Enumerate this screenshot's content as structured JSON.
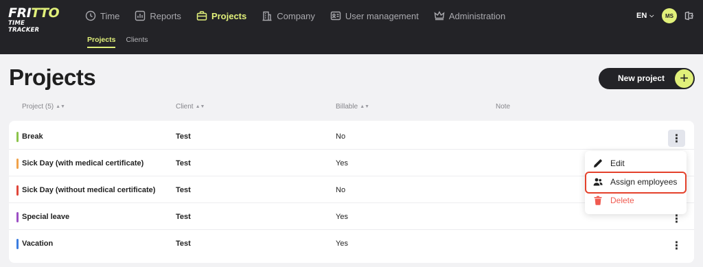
{
  "app": {
    "logo_top_a": "FRI",
    "logo_top_b": "TTO",
    "logo_sub": "TIME TRACKER"
  },
  "nav": {
    "items": [
      {
        "label": "Time",
        "icon": "clock-icon"
      },
      {
        "label": "Reports",
        "icon": "bar-chart-icon"
      },
      {
        "label": "Projects",
        "icon": "briefcase-icon"
      },
      {
        "label": "Company",
        "icon": "building-icon"
      },
      {
        "label": "User management",
        "icon": "id-card-icon"
      },
      {
        "label": "Administration",
        "icon": "crown-icon"
      }
    ],
    "active": "Projects"
  },
  "subnav": {
    "items": [
      {
        "label": "Projects"
      },
      {
        "label": "Clients"
      }
    ],
    "active": "Projects"
  },
  "header": {
    "language": "EN",
    "avatar_initials": "MS"
  },
  "page": {
    "title": "Projects",
    "new_project_label": "New project"
  },
  "table": {
    "columns": [
      {
        "label": "Project (5)"
      },
      {
        "label": "Client"
      },
      {
        "label": "Billable"
      },
      {
        "label": "Note"
      }
    ],
    "rows": [
      {
        "name": "Break",
        "client": "Test",
        "billable": "No",
        "color": "#8bc34a"
      },
      {
        "name": "Sick Day (with medical certificate)",
        "client": "Test",
        "billable": "Yes",
        "color": "#f0a24a"
      },
      {
        "name": "Sick Day (without medical certificate)",
        "client": "Test",
        "billable": "No",
        "color": "#e0463a"
      },
      {
        "name": "Special leave",
        "client": "Test",
        "billable": "Yes",
        "color": "#9c4fc4"
      },
      {
        "name": "Vacation",
        "client": "Test",
        "billable": "Yes",
        "color": "#3b7de0"
      }
    ]
  },
  "row_menu": {
    "items": [
      {
        "label": "Edit",
        "icon": "pencil-icon"
      },
      {
        "label": "Assign employees",
        "icon": "users-icon"
      },
      {
        "label": "Delete",
        "icon": "trash-icon"
      }
    ]
  },
  "colors": {
    "accent": "#e1f07a",
    "topbar": "#232327",
    "danger": "#f05a50",
    "highlight": "#e4402a"
  }
}
